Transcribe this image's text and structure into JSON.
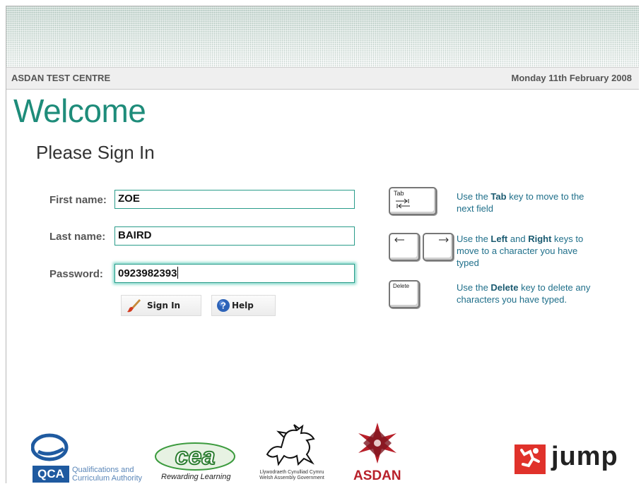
{
  "header": {
    "centre_name": "ASDAN TEST CENTRE",
    "date": "Monday 11th February 2008"
  },
  "main": {
    "welcome": "Welcome",
    "signin_title": "Please Sign In"
  },
  "form": {
    "first_name_label": "First name:",
    "first_name_value": "ZOE",
    "last_name_label": "Last name:",
    "last_name_value": "BAIRD",
    "password_label": "Password:",
    "password_value": "0923982393",
    "signin_button": "Sign In",
    "help_button": "Help"
  },
  "hints": {
    "tab_key": "Tab",
    "tab_pre": "Use the ",
    "tab_bold": "Tab",
    "tab_post": " key to move to the next field",
    "arrows_pre": "Use the ",
    "arrows_bold1": "Left",
    "arrows_mid": " and ",
    "arrows_bold2": "Right",
    "arrows_post": " keys to move to a character you have typed",
    "delete_key": "Delete",
    "delete_pre": "Use the ",
    "delete_bold": "Delete",
    "delete_post": " key to delete any characters you have typed."
  },
  "footer": {
    "qca_abbr": "QCA",
    "qca_line1": "Qualifications and",
    "qca_line2": "Curriculum Authority",
    "cea_name": "cea",
    "cea_tagline": "Rewarding Learning",
    "welsh_line1": "Llywodraeth Cynulliad Cymru",
    "welsh_line2": "Welsh Assembly Government",
    "asdan": "ASDAN",
    "jump": "jump"
  },
  "colors": {
    "accent": "#1e8c7a",
    "hint_text": "#1f6f8a",
    "asdan_red": "#b8202a",
    "jump_red": "#e0322b",
    "qca_blue": "#1f5aa0"
  }
}
